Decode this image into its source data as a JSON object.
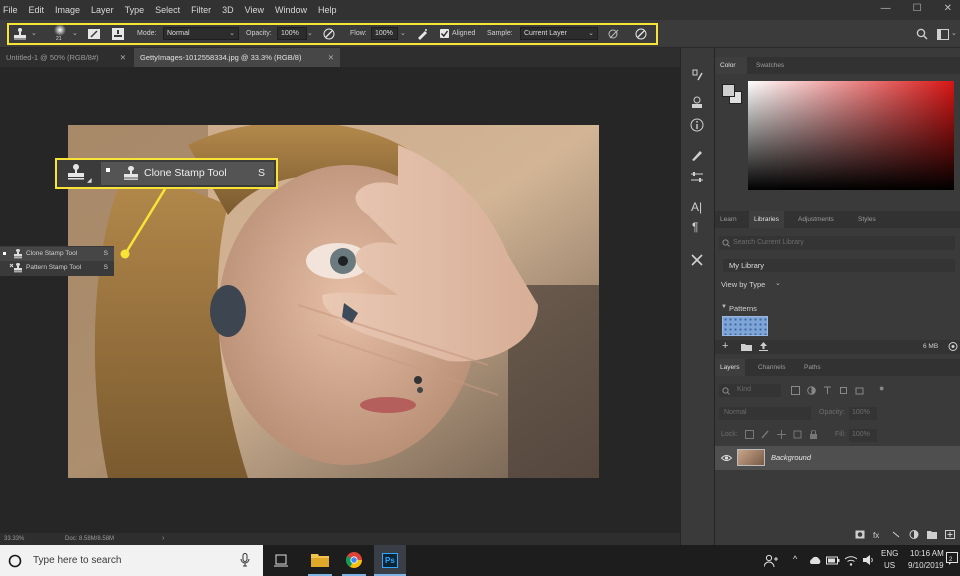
{
  "menu": [
    "File",
    "Edit",
    "Image",
    "Layer",
    "Type",
    "Select",
    "Filter",
    "3D",
    "View",
    "Window",
    "Help"
  ],
  "window_controls": {
    "minimize": "—",
    "maximize": "☐",
    "close": "✕"
  },
  "options_bar": {
    "brush_size": "21",
    "mode_label": "Mode:",
    "mode_value": "Normal",
    "opacity_label": "Opacity:",
    "opacity_value": "100%",
    "flow_label": "Flow:",
    "flow_value": "100%",
    "aligned_label": "Aligned",
    "aligned_checked": true,
    "sample_label": "Sample:",
    "sample_value": "Current Layer"
  },
  "doc_tabs": [
    {
      "label": "Untitled-1 @ 50% (RGB/8#)",
      "active": false
    },
    {
      "label": "GettyImages-1012558334.jpg @ 33.3% (RGB/8)",
      "active": true
    }
  ],
  "callout": {
    "label": "Clone Stamp Tool",
    "shortcut": "S"
  },
  "tool_flyout": [
    {
      "label": "Clone Stamp Tool",
      "shortcut": "S",
      "selected": true
    },
    {
      "label": "Pattern Stamp Tool",
      "shortcut": "S",
      "selected": false
    }
  ],
  "status": {
    "zoom": "33.33%",
    "doc": "Doc: 8.58M/8.58M"
  },
  "color_panel": {
    "tabs": [
      "Color",
      "Swatches"
    ],
    "hue_color": "#d81515"
  },
  "libraries_panel": {
    "tabs": [
      "Learn",
      "Libraries",
      "Adjustments",
      "Styles"
    ],
    "search_placeholder": "Search Current Library",
    "library_name": "My Library",
    "view_by": "View by Type",
    "section": "Patterns",
    "size": "6 MB"
  },
  "layers_panel": {
    "tabs": [
      "Layers",
      "Channels",
      "Paths"
    ],
    "kind_label": "Kind",
    "blend_mode": "Normal",
    "opacity_label": "Opacity:",
    "opacity_value": "100%",
    "lock_label": "Lock:",
    "fill_label": "Fill:",
    "fill_value": "100%",
    "layer_name": "Background"
  },
  "taskbar": {
    "search_placeholder": "Type here to search",
    "lang_top": "ENG",
    "lang_bottom": "US",
    "time": "10:16 AM",
    "date": "9/10/2019",
    "notifications": "2"
  },
  "accent_color": "#f7e436"
}
